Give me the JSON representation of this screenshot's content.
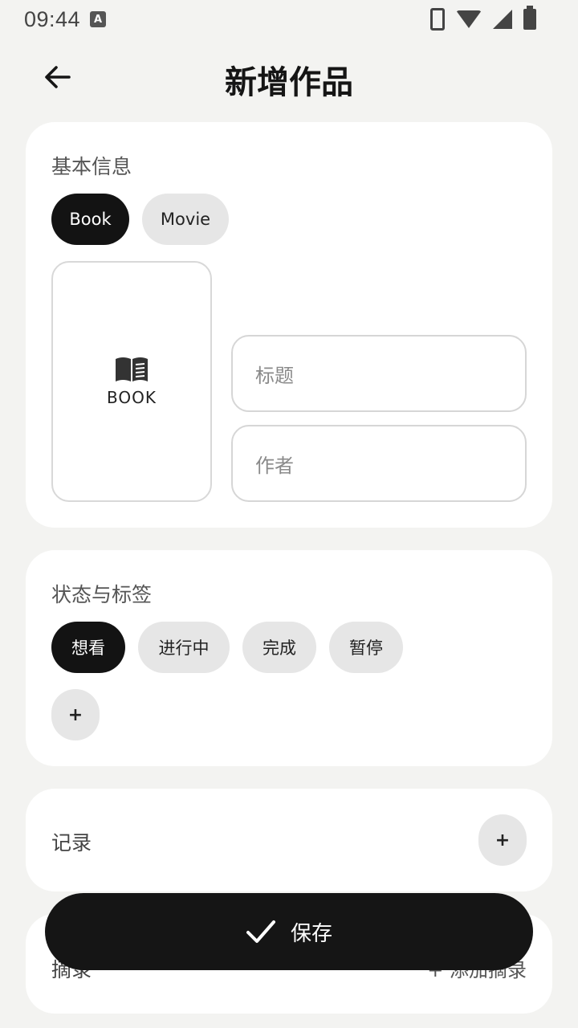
{
  "status_bar": {
    "time": "09:44",
    "notification_glyph": "A"
  },
  "header": {
    "title": "新增作品"
  },
  "basic_info": {
    "section_title": "基本信息",
    "type_chips": [
      {
        "label": "Book",
        "selected": true
      },
      {
        "label": "Movie",
        "selected": false
      }
    ],
    "cover_label": "BOOK",
    "title_placeholder": "标题",
    "author_placeholder": "作者"
  },
  "status_tags": {
    "section_title": "状态与标签",
    "chips": [
      {
        "label": "想看",
        "selected": true
      },
      {
        "label": "进行中",
        "selected": false
      },
      {
        "label": "完成",
        "selected": false
      },
      {
        "label": "暂停",
        "selected": false
      }
    ],
    "add_label": "+"
  },
  "records": {
    "label": "记录",
    "add_label": "+"
  },
  "excerpts": {
    "label": "摘录",
    "action_label": "+ 添加摘录"
  },
  "save_button": {
    "label": "保存"
  },
  "colors": {
    "accent": "#131313",
    "chip_bg": "#e6e6e6",
    "page_bg": "#f3f3f1"
  }
}
